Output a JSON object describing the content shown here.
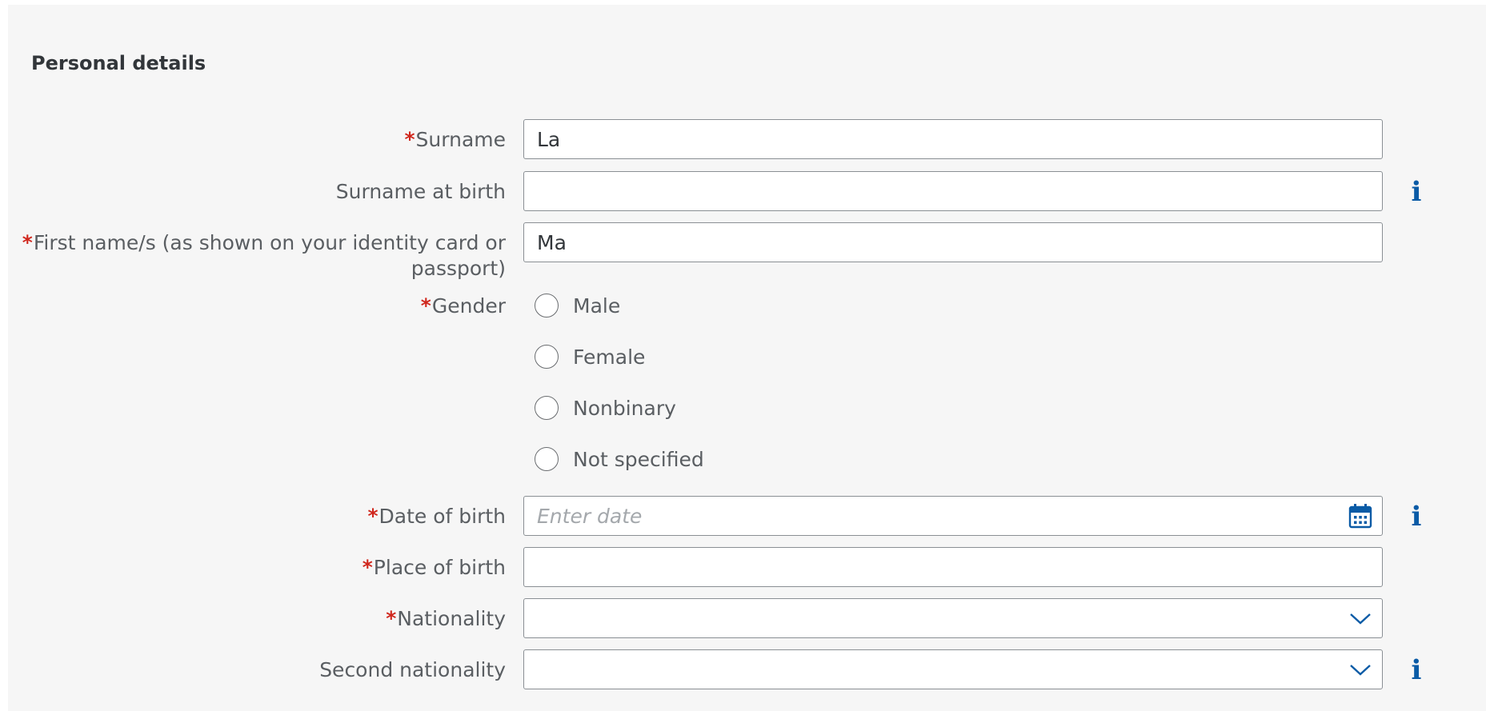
{
  "section": {
    "title": "Personal details"
  },
  "required_marker": "*",
  "fields": {
    "surname": {
      "label": "Surname",
      "value": "La"
    },
    "surname_at_birth": {
      "label": "Surname at birth",
      "value": ""
    },
    "first_names": {
      "label": "First name/s (as shown on your identity card or passport)",
      "value": "Ma"
    },
    "gender": {
      "label": "Gender",
      "options": [
        "Male",
        "Female",
        "Nonbinary",
        "Not specified"
      ]
    },
    "date_of_birth": {
      "label": "Date of birth",
      "placeholder": "Enter date"
    },
    "place_of_birth": {
      "label": "Place of birth",
      "value": ""
    },
    "nationality": {
      "label": "Nationality",
      "value": ""
    },
    "second_nationality": {
      "label": "Second nationality",
      "value": ""
    }
  },
  "icons": {
    "info": "i",
    "calendar": "calendar-icon",
    "dropdown": "chevron-down-icon"
  },
  "colors": {
    "background": "#f6f6f6",
    "required": "#d0271d",
    "accent": "#0a5ba6",
    "border": "#8a8f94",
    "label": "#5a5e62"
  }
}
